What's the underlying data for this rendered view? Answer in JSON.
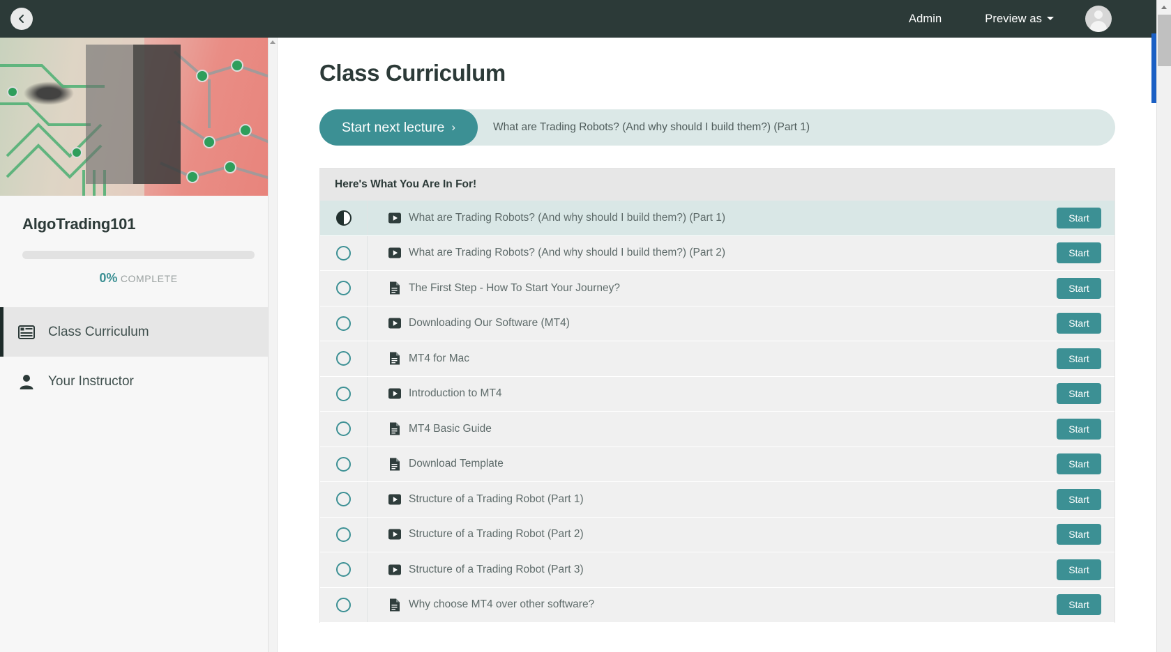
{
  "topbar": {
    "back_icon": "chevron-left-icon",
    "admin_label": "Admin",
    "preview_label": "Preview as",
    "avatar_icon": "user-avatar-icon"
  },
  "sidebar": {
    "course_title": "AlgoTrading101",
    "progress_percent": "0%",
    "progress_label": "COMPLETE",
    "progress_value": 0,
    "items": [
      {
        "label": "Class Curriculum",
        "icon": "list-icon",
        "active": true
      },
      {
        "label": "Your Instructor",
        "icon": "person-icon",
        "active": false
      }
    ]
  },
  "main": {
    "page_title": "Class Curriculum",
    "next_button_label": "Start next lecture",
    "next_button_chevron": "›",
    "next_lecture_title": "What are Trading Robots? (And why should I build them?) (Part 1)",
    "section_title": "Here's What You Are In For!",
    "start_label": "Start",
    "lectures": [
      {
        "title": "What are Trading Robots? (And why should I build them?) (Part 1)",
        "type": "video",
        "status": "in-progress",
        "action": "Start"
      },
      {
        "title": "What are Trading Robots? (And why should I build them?) (Part 2)",
        "type": "video",
        "status": "incomplete",
        "action": "Start"
      },
      {
        "title": "The First Step - How To Start Your Journey?",
        "type": "document",
        "status": "incomplete",
        "action": "Start"
      },
      {
        "title": "Downloading Our Software (MT4)",
        "type": "video",
        "status": "incomplete",
        "action": "Start"
      },
      {
        "title": "MT4 for Mac",
        "type": "document",
        "status": "incomplete",
        "action": "Start"
      },
      {
        "title": "Introduction to MT4",
        "type": "video",
        "status": "incomplete",
        "action": "Start"
      },
      {
        "title": "MT4 Basic Guide",
        "type": "document",
        "status": "incomplete",
        "action": "Start"
      },
      {
        "title": "Download Template",
        "type": "document",
        "status": "incomplete",
        "action": "Start"
      },
      {
        "title": "Structure of a Trading Robot (Part 1)",
        "type": "video",
        "status": "incomplete",
        "action": "Start"
      },
      {
        "title": "Structure of a Trading Robot (Part 2)",
        "type": "video",
        "status": "incomplete",
        "action": "Start"
      },
      {
        "title": "Structure of a Trading Robot (Part 3)",
        "type": "video",
        "status": "incomplete",
        "action": "Start"
      },
      {
        "title": "Why choose MT4 over other software?",
        "type": "document",
        "status": "incomplete",
        "action": "Start"
      }
    ]
  },
  "colors": {
    "accent_teal": "#3c9094",
    "topbar_dark": "#2c3a38",
    "banner_bg": "#dbe8e7",
    "row_bg": "#f0f0f0",
    "row_current_bg": "#d9e7e6",
    "section_head_bg": "#e7e7e7",
    "scroll_blue": "#1a5fc4"
  }
}
